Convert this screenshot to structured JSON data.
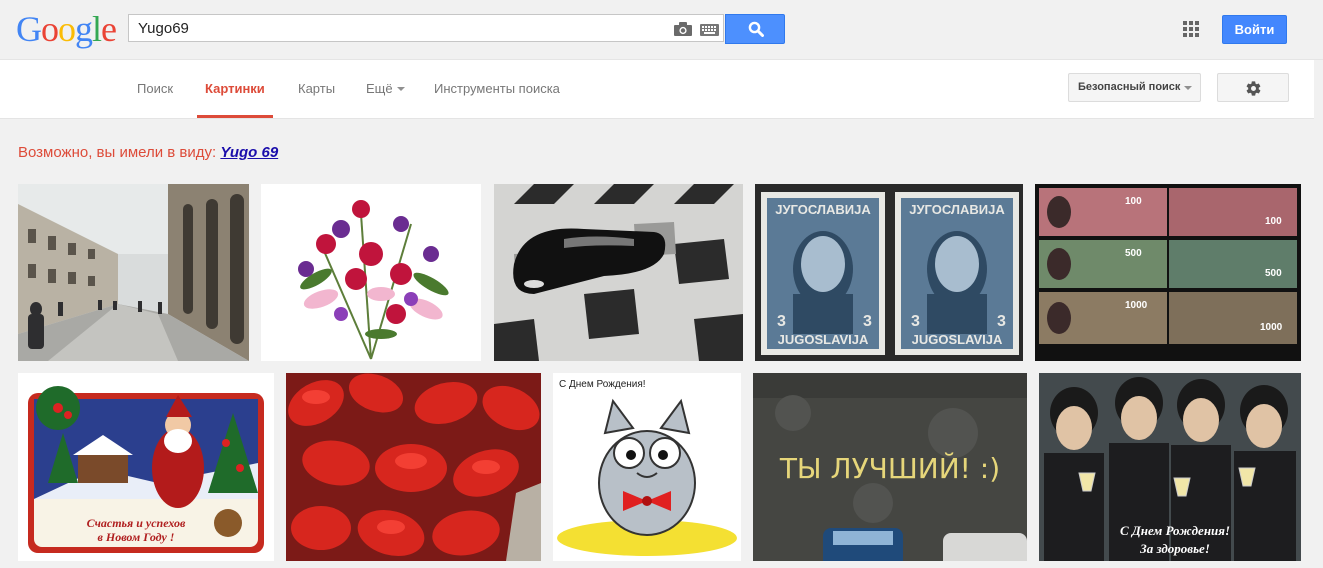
{
  "header": {
    "logo_letters": [
      {
        "ch": "G",
        "color": "#4285f4"
      },
      {
        "ch": "o",
        "color": "#ea4335"
      },
      {
        "ch": "o",
        "color": "#fbbc05"
      },
      {
        "ch": "g",
        "color": "#4285f4"
      },
      {
        "ch": "l",
        "color": "#34a853"
      },
      {
        "ch": "e",
        "color": "#ea4335"
      }
    ],
    "search_value": "Yugo69",
    "signin_label": "Войти",
    "icons": [
      "camera-icon",
      "keyboard-icon",
      "search-icon",
      "apps-grid-icon"
    ]
  },
  "nav": {
    "tabs": [
      "Поиск",
      "Картинки",
      "Карты",
      "Ещё",
      "Инструменты поиска"
    ],
    "active_tab": "Картинки",
    "safe_search_label": "Безопасный поиск",
    "settings_icon": "gear-icon"
  },
  "suggestion": {
    "prefix": "Возможно, вы имели в виду:",
    "link": "Yugo 69"
  },
  "results": {
    "images": [
      {
        "subject": "old-town-street",
        "caption": ""
      },
      {
        "subject": "flower-bouquet",
        "caption": ""
      },
      {
        "subject": "shoe-on-tiles",
        "caption": ""
      },
      {
        "subject": "yugoslavia-stamps",
        "caption": "",
        "stamp_top_text": "ЈУГОСЛАВИЈА",
        "stamp_bottom_text": "JUGOSLAVIJA",
        "stamp_value": "3"
      },
      {
        "subject": "banknotes",
        "caption": "",
        "notes": [
          "100",
          "500",
          "1000"
        ]
      },
      {
        "subject": "new-year-card",
        "caption": "Счастья и успехов\nв Новом Году !"
      },
      {
        "subject": "red-tulips",
        "caption": ""
      },
      {
        "subject": "birthday-cat",
        "caption": "С Днем Рождения!"
      },
      {
        "subject": "chalk-on-asphalt",
        "caption": "ТЫ ЛУЧШИЙ! :)"
      },
      {
        "subject": "beatles-toast",
        "caption": "С Днем Рождения!\nЗа здоровье!"
      }
    ]
  },
  "colors": {
    "accent_red": "#dd4b39",
    "link_blue": "#1a0dab",
    "button_blue": "#4d90fe"
  }
}
